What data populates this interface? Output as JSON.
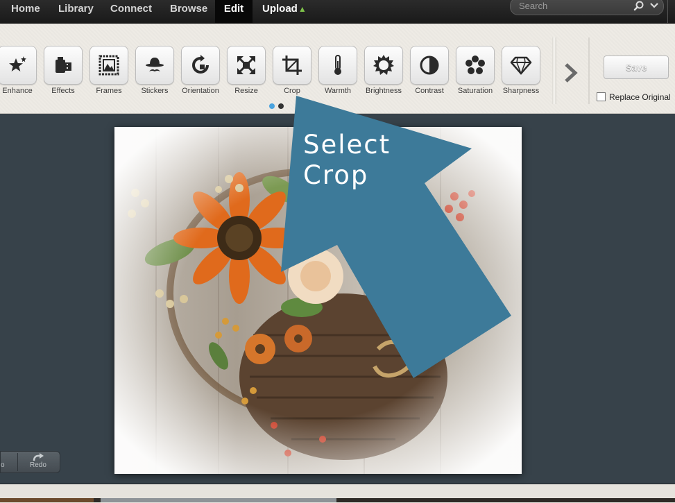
{
  "nav": {
    "items": [
      {
        "label": "Home"
      },
      {
        "label": "Library"
      },
      {
        "label": "Connect"
      },
      {
        "label": "Browse"
      },
      {
        "label": "Edit",
        "active": true
      },
      {
        "label": "Upload"
      }
    ],
    "search_placeholder": "Search"
  },
  "toolbar": {
    "tools": [
      {
        "label": "Enhance",
        "icon": "star-magic-icon"
      },
      {
        "label": "Effects",
        "icon": "film-canister-icon"
      },
      {
        "label": "Frames",
        "icon": "picture-frame-icon"
      },
      {
        "label": "Stickers",
        "icon": "bowler-hat-mustache-icon"
      },
      {
        "label": "Orientation",
        "icon": "rotate-icon"
      },
      {
        "label": "Resize",
        "icon": "resize-arrows-icon"
      },
      {
        "label": "Crop",
        "icon": "crop-icon"
      },
      {
        "label": "Warmth",
        "icon": "thermometer-icon"
      },
      {
        "label": "Brightness",
        "icon": "sun-icon"
      },
      {
        "label": "Contrast",
        "icon": "half-circle-icon"
      },
      {
        "label": "Saturation",
        "icon": "flower-dots-icon"
      },
      {
        "label": "Sharpness",
        "icon": "diamond-icon"
      }
    ],
    "page_dots": {
      "count": 2,
      "active_index": 0
    },
    "save_label": "Save",
    "replace_original_label": "Replace Original",
    "replace_original_checked": false
  },
  "canvas": {
    "redo_label": "Redo",
    "undo_label_partial": "o"
  },
  "annotation": {
    "text_line1": "Select",
    "text_line2": "Crop",
    "color": "#3d7a99"
  },
  "colors": {
    "active_dot": "#4aa3df",
    "inactive_dot": "#333333",
    "upload_arrow": "#7ec14a"
  }
}
